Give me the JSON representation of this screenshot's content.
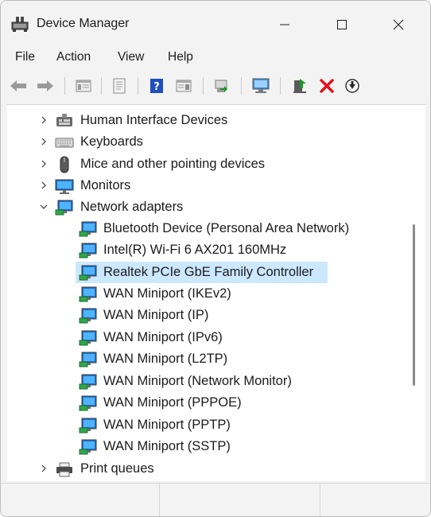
{
  "window": {
    "title": "Device Manager"
  },
  "menu": {
    "items": [
      "File",
      "Action",
      "View",
      "Help"
    ]
  },
  "toolbar": {
    "buttons": [
      "back-arrow-icon",
      "forward-arrow-icon",
      "properties-grid-icon",
      "document-icon",
      "help-icon",
      "console-tree-icon",
      "update-driver-icon",
      "scan-hardware-icon",
      "enable-device-icon",
      "uninstall-x-icon",
      "disable-device-icon"
    ],
    "accent_colors": {
      "help": "#1c4fbf",
      "uninstall": "#e0121b",
      "enable": "#1a9a2a"
    }
  },
  "tree": {
    "categories": [
      {
        "label": "Human Interface Devices",
        "icon": "hid-icon",
        "expanded": false
      },
      {
        "label": "Keyboards",
        "icon": "keyboard-icon",
        "expanded": false
      },
      {
        "label": "Mice and other pointing devices",
        "icon": "mouse-icon",
        "expanded": false
      },
      {
        "label": "Monitors",
        "icon": "monitor-icon",
        "expanded": false
      },
      {
        "label": "Network adapters",
        "icon": "network-adapter-icon",
        "expanded": true
      }
    ],
    "network_children": [
      "Bluetooth Device (Personal Area Network)",
      "Intel(R) Wi-Fi 6 AX201 160MHz",
      "Realtek PCIe GbE Family Controller",
      "WAN Miniport (IKEv2)",
      "WAN Miniport (IP)",
      "WAN Miniport (IPv6)",
      "WAN Miniport (L2TP)",
      "WAN Miniport (Network Monitor)",
      "WAN Miniport (PPPOE)",
      "WAN Miniport (PPTP)",
      "WAN Miniport (SSTP)"
    ],
    "selected_child": "Realtek PCIe GbE Family Controller",
    "after": {
      "label": "Print queues",
      "icon": "printer-icon",
      "expanded": false
    },
    "selection_color": "#cce8ff"
  }
}
